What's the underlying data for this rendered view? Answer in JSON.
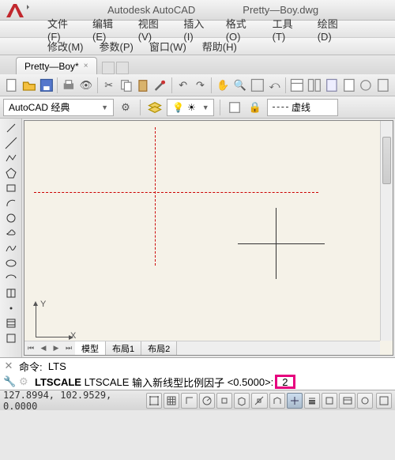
{
  "title": {
    "app": "Autodesk AutoCAD",
    "file": "Pretty—Boy.dwg"
  },
  "menu1": [
    "文件(F)",
    "编辑(E)",
    "视图(V)",
    "插入(I)",
    "格式(O)",
    "工具(T)",
    "绘图(D)"
  ],
  "menu2": [
    "修改(M)",
    "参数(P)",
    "窗口(W)",
    "帮助(H)"
  ],
  "doc_tab": {
    "label": "Pretty—Boy*",
    "close": "×"
  },
  "workspace": {
    "label": "AutoCAD 经典"
  },
  "linetype": {
    "label": "虚线"
  },
  "model_tabs": {
    "model": "模型",
    "layout1": "布局1",
    "layout2": "布局2"
  },
  "ucs": {
    "x": "X",
    "y": "Y"
  },
  "cmd": {
    "line1_prefix": "命令:",
    "line1_cmd": "LTS",
    "line2_a": "LTSCALE",
    "line2_b": "LTSCALE",
    "line2_prompt": "输入新线型比例因子",
    "line2_default": "<0.5000>:",
    "line2_input": "2"
  },
  "status": {
    "coords": "127.8994, 102.9529, 0.0000"
  }
}
